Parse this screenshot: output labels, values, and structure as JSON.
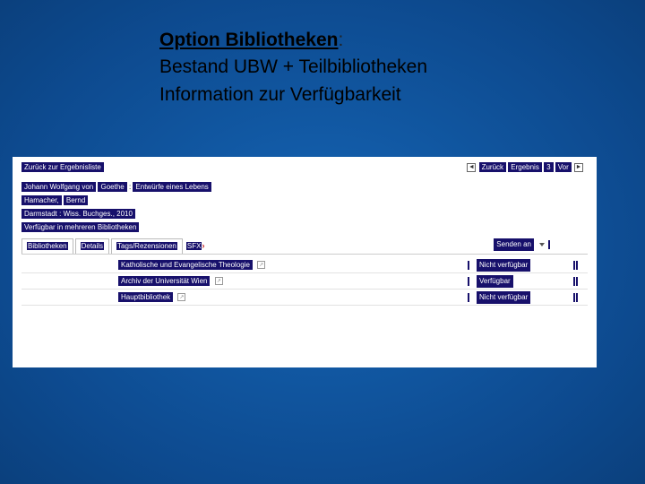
{
  "title": {
    "main": "Option Bibliotheken",
    "colon": ":",
    "line2": "Bestand UBW + Teilbibliotheken",
    "line3": "Information zur Verfügbarkeit"
  },
  "nav": {
    "back": "Zurück zur Ergebnisliste",
    "prev_label": "Zurück",
    "result_word": "Ergebnis",
    "result_num": "3",
    "next_label": "Vor"
  },
  "record": {
    "author_hl1": "Johann Wolfgang von",
    "author_hl2": "Goethe",
    "title_plain_sep": " : ",
    "title_rest_hl": "Entwürfe eines Lebens",
    "creator_hl1": "Hamacher,",
    "creator_hl2": "Bernd",
    "imprint": "Darmstadt : Wiss. Buchges., 2010",
    "avail": "Verfügbar in mehreren Bibliotheken"
  },
  "tabs": {
    "t1": "Bibliotheken",
    "t2": "Details",
    "t3": "Tags/Rezensionen",
    "t4": "SFX",
    "send": "Senden an"
  },
  "rows": [
    {
      "library": "Katholische und Evangelische Theologie",
      "status": "Nicht verfügbar"
    },
    {
      "library": "Archiv der Universität Wien",
      "status": "Verfügbar"
    },
    {
      "library": "Hauptbibliothek",
      "status": "Nicht verfügbar"
    }
  ]
}
